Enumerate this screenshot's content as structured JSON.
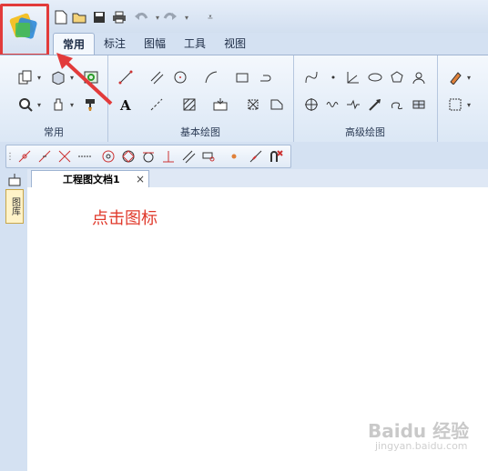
{
  "ribbon": {
    "tabs": [
      "常用",
      "标注",
      "图幅",
      "工具",
      "视图"
    ],
    "groups": {
      "common": "常用",
      "basic_draw": "基本绘图",
      "advanced_draw": "高级绘图"
    }
  },
  "document": {
    "tab_title": "工程图文档1",
    "close_glyph": "×"
  },
  "side_panel": {
    "label": "图库"
  },
  "annotation": {
    "callout": "点击图标",
    "arrow_color": "#e23b3b"
  },
  "watermark": {
    "text": "Baidu 经验",
    "url_text": "jingyan.baidu.com"
  },
  "colors": {
    "ribbon_bg": "#dbe7f5",
    "highlight_box": "#e23b3b",
    "callout_text": "#e0392b"
  }
}
